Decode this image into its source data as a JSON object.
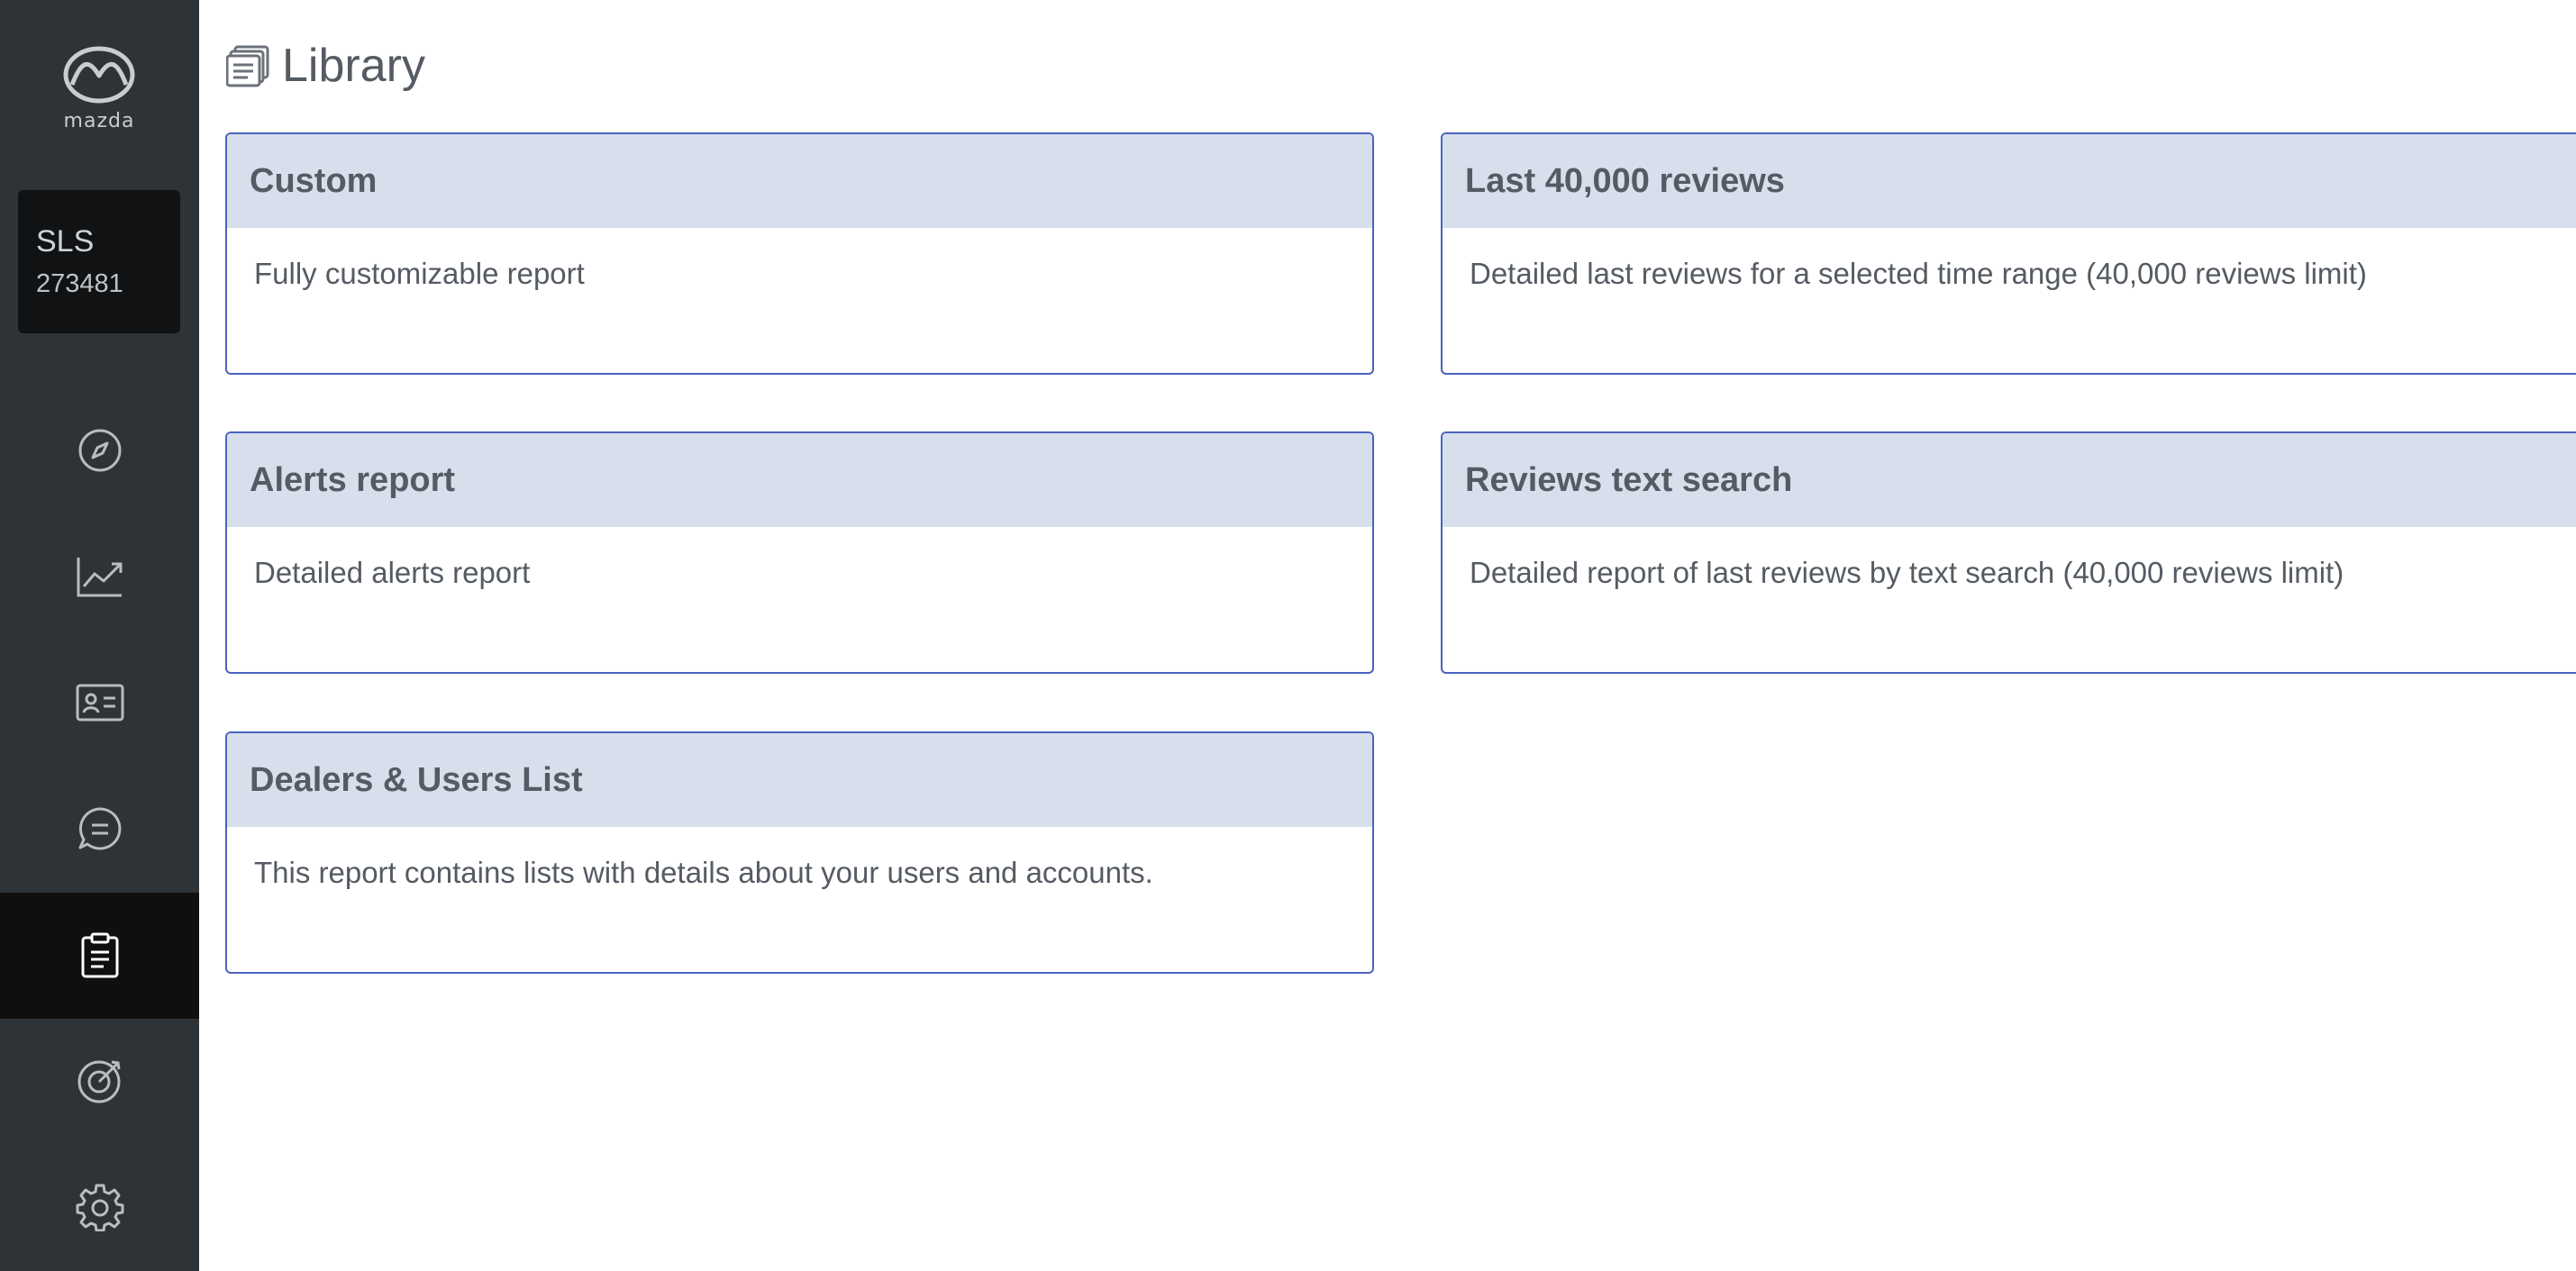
{
  "brand": {
    "logo_text": "mazda",
    "logo_icon": "mazda-logo"
  },
  "account": {
    "code": "SLS",
    "id": "273481"
  },
  "nav": [
    {
      "icon": "compass-icon",
      "active": false
    },
    {
      "icon": "trend-chart-icon",
      "active": false
    },
    {
      "icon": "contact-card-icon",
      "active": false
    },
    {
      "icon": "chat-bubble-icon",
      "active": false
    },
    {
      "icon": "clipboard-icon",
      "active": true
    },
    {
      "icon": "target-icon",
      "active": false
    },
    {
      "icon": "gear-icon",
      "active": false
    }
  ],
  "page": {
    "icon": "documents-stack-icon",
    "title": "Library"
  },
  "reports": [
    {
      "title": "Custom",
      "description": "Fully customizable report"
    },
    {
      "title": "Last 40,000 reviews",
      "description": "Detailed last reviews for a selected time range (40,000 reviews limit)"
    },
    {
      "title": "Alerts report",
      "description": "Detailed alerts report"
    },
    {
      "title": "Reviews text search",
      "description": "Detailed report of last reviews by text search (40,000 reviews limit)"
    },
    {
      "title": "Dealers & Users List",
      "description": "This report contains lists with details about your users and accounts."
    }
  ],
  "colors": {
    "sidebar_bg": "#2e3338",
    "sidebar_active": "#0f0f10",
    "card_border": "#4a63c0",
    "card_header_bg": "#d8dfec",
    "text": "#555b63"
  }
}
